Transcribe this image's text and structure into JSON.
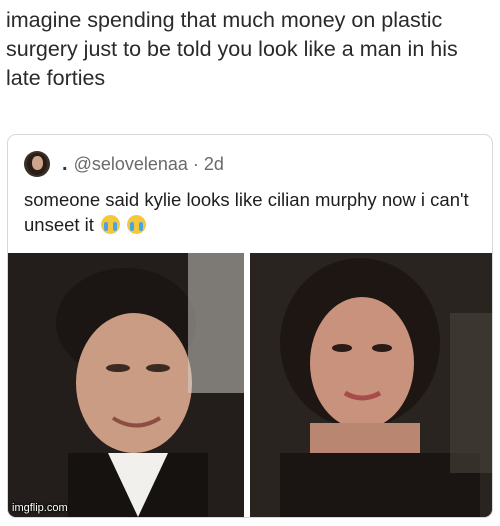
{
  "caption": "imagine spending that much money on plastic surgery just to be told you look like a man in his late forties",
  "tweet": {
    "handle": "@selovelenaa · 2d",
    "text": "someone said kylie looks like cilian murphy now i can't unseet it",
    "emoji_icon": "loudly-crying-face-icon"
  },
  "watermark": "imgflip.com"
}
